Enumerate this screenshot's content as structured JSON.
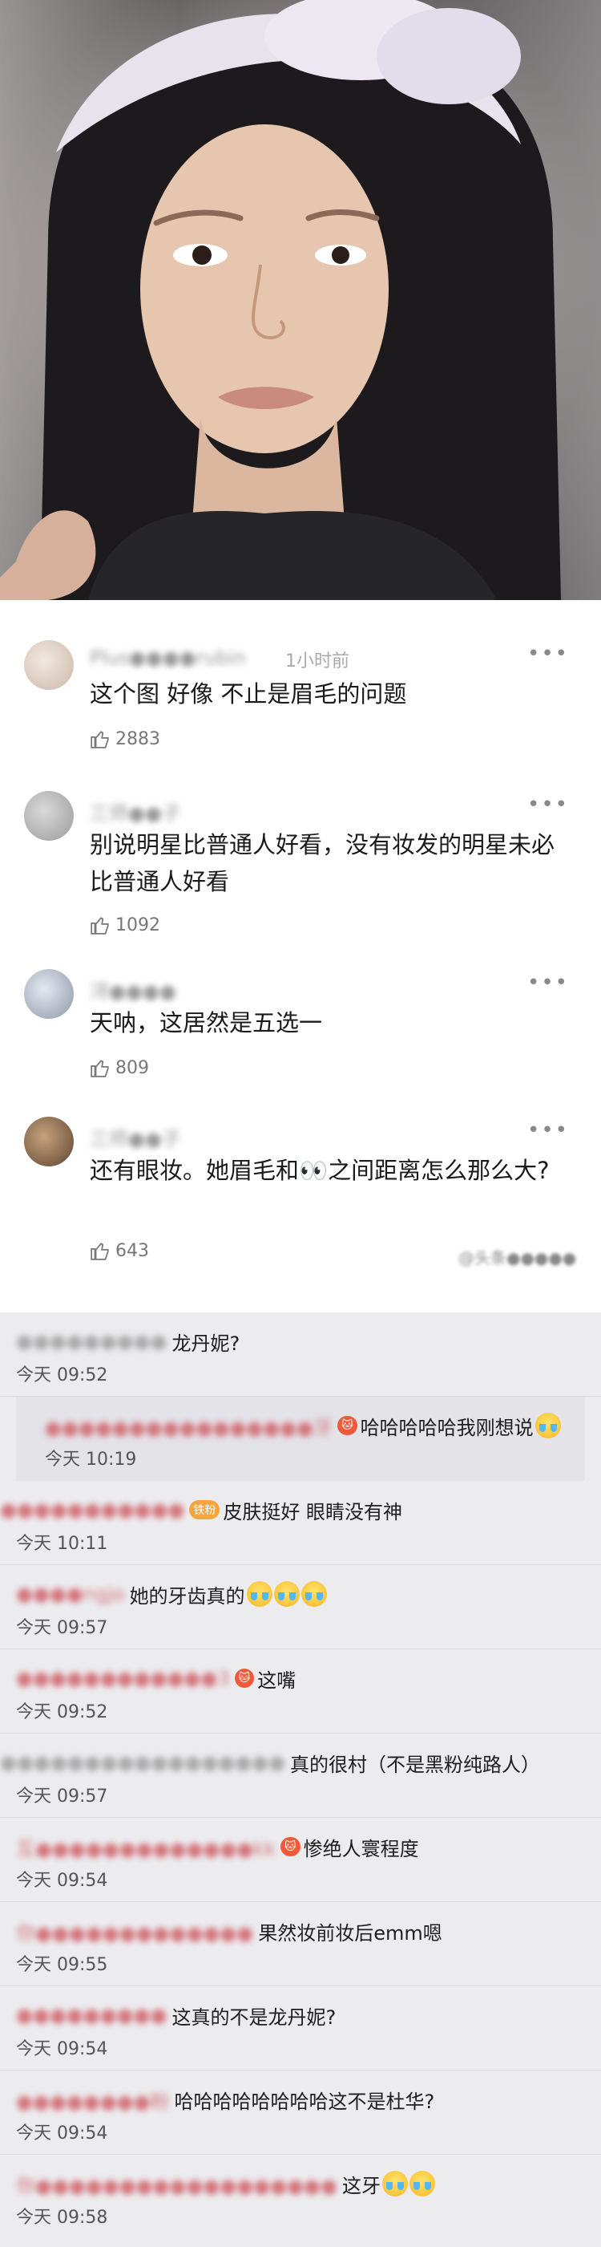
{
  "comments": [
    {
      "username": "Plus●●●●rubin",
      "time": "1小时前",
      "text": "这个图 好像 不止是眉毛的问题",
      "likes": "2883"
    },
    {
      "username": "三师●●子",
      "time": "",
      "text": "别说明星比普通人好看，没有妆发的明星未必比普通人好看",
      "likes": "1092"
    },
    {
      "username": "浔●●●●",
      "time": "",
      "text": "天呐，这居然是五选一",
      "likes": "809"
    },
    {
      "username": "三师●●子",
      "time": "",
      "text": "还有眼妆。她眉毛和👀之间距离怎么那么大?",
      "likes": "643"
    }
  ],
  "watermark": "@头条●●●●●",
  "chat": [
    {
      "nick": "●●●●●●●●●",
      "badge": "",
      "text": "龙丹妮?",
      "time": "今天 09:52",
      "emoji": 0
    },
    {
      "nick": "●●●●●●●●●●●●●●●●牙",
      "badge": "🐱",
      "text": "哈哈哈哈哈我刚想说",
      "time": "今天 10:19",
      "emoji": 1
    },
    {
      "nick": "●●●●●●●●●●●",
      "badge": "铁粉",
      "text": "皮肤挺好 眼睛没有神",
      "time": "今天 10:11",
      "emoji": 0
    },
    {
      "nick": "●●●●ngjo",
      "badge": "",
      "text": "她的牙齿真的",
      "time": "今天 09:57",
      "emoji": 3
    },
    {
      "nick": "●●●●●●●●●●●●3",
      "badge": "🐱",
      "text": "这嘴",
      "time": "今天 09:52",
      "emoji": 0
    },
    {
      "nick": "●●●●●●●●●●●●●●●●●",
      "badge": "",
      "text": "真的很村（不是黑粉纯路人）",
      "time": "今天 09:57",
      "emoji": 0
    },
    {
      "nick": "互●●●●●●●●●●●●●kk",
      "badge": "🐱",
      "text": "惨绝人寰程度",
      "time": "今天 09:54",
      "emoji": 0
    },
    {
      "nick": "你●●●●●●●●●●●●●",
      "badge": "",
      "text": "果然妆前妆后emm嗯",
      "time": "今天 09:55",
      "emoji": 0
    },
    {
      "nick": "●●●●●●●●●",
      "badge": "",
      "text": "这真的不是龙丹妮?",
      "time": "今天 09:54",
      "emoji": 0
    },
    {
      "nick": "●●●●●●●●粉",
      "badge": "",
      "text": "哈哈哈哈哈哈哈哈这不是杜华?",
      "time": "今天 09:54",
      "emoji": 0
    },
    {
      "nick": "你●●●●●●●●●●●●●●●●●●",
      "badge": "",
      "text": "这牙",
      "time": "今天 09:58",
      "emoji": 2
    }
  ]
}
